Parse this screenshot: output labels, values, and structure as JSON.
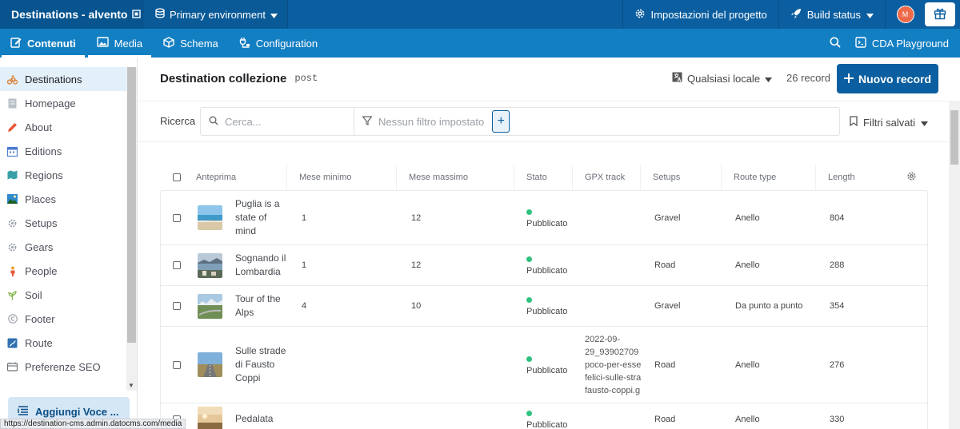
{
  "topbar": {
    "project_name": "Destinations - alvento",
    "environment": "Primary environment",
    "settings": "Impostazioni del progetto",
    "build_status": "Build status",
    "avatar_initial": "M"
  },
  "nav": {
    "tabs": [
      {
        "label": "Contenuti",
        "icon": "edit-icon"
      },
      {
        "label": "Media",
        "icon": "image-icon"
      },
      {
        "label": "Schema",
        "icon": "cube-icon"
      },
      {
        "label": "Configuration",
        "icon": "plugs-icon"
      }
    ],
    "cda": "CDA Playground"
  },
  "sidebar": {
    "items": [
      {
        "label": "Destinations",
        "icon": "bike-icon",
        "color": "#d9823b"
      },
      {
        "label": "Homepage",
        "icon": "page-icon",
        "color": "#b9c0c8"
      },
      {
        "label": "About",
        "icon": "pencil-icon",
        "color": "#e8573a"
      },
      {
        "label": "Editions",
        "icon": "calendar-icon",
        "color": "#4a7bd0"
      },
      {
        "label": "Regions",
        "icon": "map-icon",
        "color": "#3aa0a8"
      },
      {
        "label": "Places",
        "icon": "landscape-icon",
        "color": "#2f8ad0"
      },
      {
        "label": "Setups",
        "icon": "gear-icon",
        "color": "#9aa0a8"
      },
      {
        "label": "Gears",
        "icon": "gear-icon",
        "color": "#9aa0a8"
      },
      {
        "label": "People",
        "icon": "person-icon",
        "color": "#f0a030"
      },
      {
        "label": "Soil",
        "icon": "plant-icon",
        "color": "#7cb342"
      },
      {
        "label": "Footer",
        "icon": "copyright-icon",
        "color": "#9aa0a8"
      },
      {
        "label": "Route",
        "icon": "route-icon",
        "color": "#2f6fb0"
      },
      {
        "label": "Preferenze SEO",
        "icon": "seo-icon",
        "color": "#6b7078"
      }
    ],
    "add_button": "Aggiungi Voce ..."
  },
  "main": {
    "title": "Destination collezione",
    "api_key": "post",
    "locale": "Qualsiasi locale",
    "count": "26 record",
    "new_button": "Nuovo record",
    "search_label": "Ricerca",
    "search_placeholder": "Cerca...",
    "filter_placeholder": "Nessun filtro impostato",
    "saved_filters": "Filtri salvati"
  },
  "table": {
    "columns": [
      "Anteprima",
      "Mese minimo",
      "Mese massimo",
      "Stato",
      "GPX track",
      "Setups",
      "Route type",
      "Length"
    ],
    "rows": [
      {
        "title": "Puglia is a state of mind",
        "min": "1",
        "max": "12",
        "status": "Pubblicato",
        "gpx": "",
        "setup": "Gravel",
        "route": "Anello",
        "length": "804",
        "thumb": "beach"
      },
      {
        "title": "Sognando il Lombardia",
        "min": "1",
        "max": "12",
        "status": "Pubblicato",
        "gpx": "",
        "setup": "Road",
        "route": "Anello",
        "length": "288",
        "thumb": "lake"
      },
      {
        "title": "Tour of the Alps",
        "min": "4",
        "max": "10",
        "status": "Pubblicato",
        "gpx": "",
        "setup": "Gravel",
        "route": "Da punto a punto",
        "length": "354",
        "thumb": "alps"
      },
      {
        "title": "Sulle strade di Fausto Coppi",
        "min": "",
        "max": "",
        "status": "Pubblicato",
        "gpx_lines": [
          "2022-09-",
          "29_93902709",
          "poco-per-esse",
          "felici-sulle-stra",
          "fausto-coppi.g"
        ],
        "setup": "Road",
        "route": "Anello",
        "length": "276",
        "thumb": "road"
      },
      {
        "title": "Pedalata",
        "min": "",
        "max": "",
        "status": "Pubblicato",
        "gpx": "",
        "setup": "Road",
        "route": "Anello",
        "length": "330",
        "thumb": "sunset"
      }
    ]
  },
  "status_url": "https://destination-cms.admin.datocms.com/media"
}
